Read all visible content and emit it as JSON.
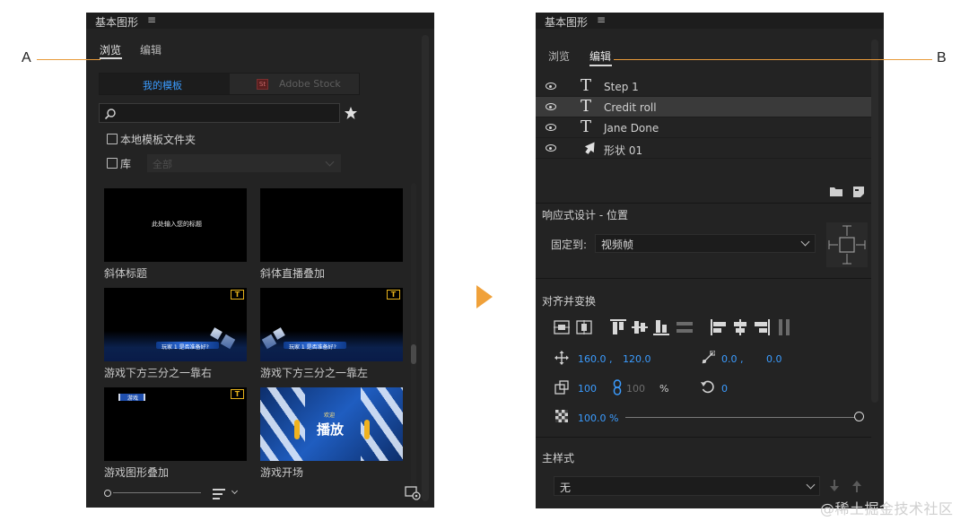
{
  "callouts": {
    "left": "A",
    "right": "B"
  },
  "watermark": "@稀土掘金技术社区",
  "left_panel": {
    "title": "基本图形",
    "menu_icon": "≡",
    "tabs": [
      {
        "label": "浏览",
        "active": true
      },
      {
        "label": "编辑",
        "active": false
      }
    ],
    "source_tabs": [
      {
        "label": "我的模板",
        "active": true
      },
      {
        "label": "Adobe Stock",
        "active": false
      }
    ],
    "search": {
      "placeholder": ""
    },
    "local_templates_label": "本地模板文件夹",
    "library_label": "库",
    "library_select_value": "全部",
    "templates": [
      {
        "name": "斜体标题",
        "preview_text": "此处输入您的标题"
      },
      {
        "name": "斜体直播叠加",
        "preview_text": ""
      },
      {
        "name": "游戏下方三分之一靠右",
        "preview_text": "玩家 1 是否准备好?"
      },
      {
        "name": "游戏下方三分之一靠左",
        "preview_text": "玩家 1 是否准备好?"
      },
      {
        "name": "游戏图形叠加",
        "preview_text": "游戏"
      },
      {
        "name": "游戏开场",
        "preview_text": "播放",
        "preview_sub": "欢迎"
      }
    ],
    "badge_text": "T"
  },
  "right_panel": {
    "title": "基本图形",
    "menu_icon": "≡",
    "tabs": [
      {
        "label": "浏览",
        "active": false
      },
      {
        "label": "编辑",
        "active": true
      }
    ],
    "layers": [
      {
        "name": "Step 1",
        "kind": "text",
        "selected": false
      },
      {
        "name": "Credit roll",
        "kind": "text",
        "selected": true
      },
      {
        "name": "Jane Done",
        "kind": "text",
        "selected": false
      },
      {
        "name": "形状 01",
        "kind": "shape",
        "selected": false
      }
    ],
    "layer_text_glyph": "T",
    "responsive": {
      "title": "响应式设计 - 位置",
      "pin_label": "固定到:",
      "pin_value": "视频帧"
    },
    "align": {
      "title": "对齐并变换",
      "position_x": "160.0 ,",
      "position_y": "120.0",
      "anchor_x": "0.0 ,",
      "anchor_y": "0.0",
      "scale": "100",
      "scale_linked": "100",
      "scale_unit": "%",
      "rotation": "0",
      "opacity": "100.0 %",
      "opacity_level": 1.0
    },
    "master_style": {
      "title": "主样式",
      "value": "无"
    }
  },
  "colors": {
    "panel_bg": "#232323",
    "accent_blue": "#3b9cff",
    "callout_orange": "#e89a3a",
    "badge_yellow": "#e6b21b",
    "arrow_orange": "#f0a13a"
  }
}
